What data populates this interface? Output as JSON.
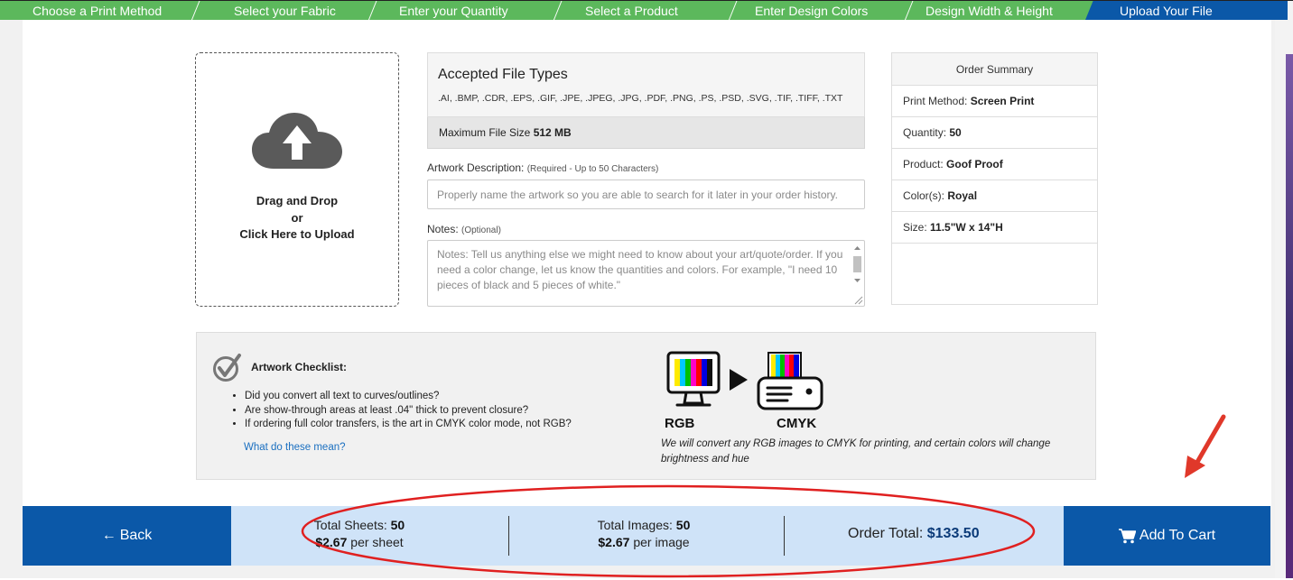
{
  "steps": {
    "items": [
      {
        "label": "Choose a Print Method"
      },
      {
        "label": "Select your Fabric"
      },
      {
        "label": "Enter your Quantity"
      },
      {
        "label": "Select a Product"
      },
      {
        "label": "Enter Design Colors"
      },
      {
        "label": "Design Width & Height"
      },
      {
        "label": "Upload Your File",
        "active": true
      }
    ],
    "color": "#5cb85c",
    "active_color": "#0b58a8"
  },
  "upload": {
    "icon": "cloud-upload-icon",
    "line1": "Drag and Drop",
    "line2": "or",
    "line3": "Click Here to Upload"
  },
  "file_info": {
    "title": "Accepted File Types",
    "types": ".AI, .BMP, .CDR, .EPS, .GIF, .JPE, .JPEG, .JPG, .PDF, .PNG, .PS, .PSD, .SVG, .TIF, .TIFF, .TXT",
    "max_size_label": "Maximum File Size ",
    "max_size_value": "512 MB"
  },
  "artwork": {
    "label": "Artwork Description: ",
    "hint": "(Required - Up to 50 Characters)",
    "placeholder": "Properly name the artwork so you are able to search for it later in your order history."
  },
  "notes": {
    "label": "Notes: ",
    "hint": "(Optional)",
    "placeholder": "Notes: Tell us anything else we might need to know about your art/quote/order. If you need a color change, let us know the quantities and colors. For example, \"I need 10 pieces of black and 5 pieces of white.\""
  },
  "summary": {
    "title": "Order Summary",
    "rows": [
      {
        "label": "Print Method: ",
        "value": "Screen Print"
      },
      {
        "label": "Quantity: ",
        "value": "50"
      },
      {
        "label": "Product: ",
        "value": "Goof Proof"
      },
      {
        "label": "Color(s): ",
        "value": "Royal"
      },
      {
        "label": "Size: ",
        "value": "11.5\"W x 14\"H"
      }
    ]
  },
  "checklist": {
    "title": "Artwork Checklist:",
    "items": [
      "Did you convert all text to curves/outlines?",
      "Are show-through areas at least .04\" thick to prevent closure?",
      "If ordering full color transfers, is the art in CMYK color mode, not RGB?"
    ],
    "link": "What do these mean?",
    "rgb_label": "RGB",
    "cmyk_label": "CMYK",
    "note": "We will convert any RGB images to CMYK for printing, and certain colors will change brightness and hue"
  },
  "footer": {
    "back": "Back",
    "sheets_label": "Total Sheets: ",
    "sheets_value": "50",
    "sheet_price": "$2.67",
    "sheet_unit": " per sheet",
    "images_label": "Total Images: ",
    "images_value": "50",
    "image_price": "$2.67",
    "image_unit": " per image",
    "total_label": "Order Total: ",
    "total_value": "$133.50",
    "cart": "Add To Cart"
  },
  "colors": {
    "primary": "#0b58a8",
    "totals_bg": "#cfe3f8",
    "annotation": "#e02020"
  }
}
